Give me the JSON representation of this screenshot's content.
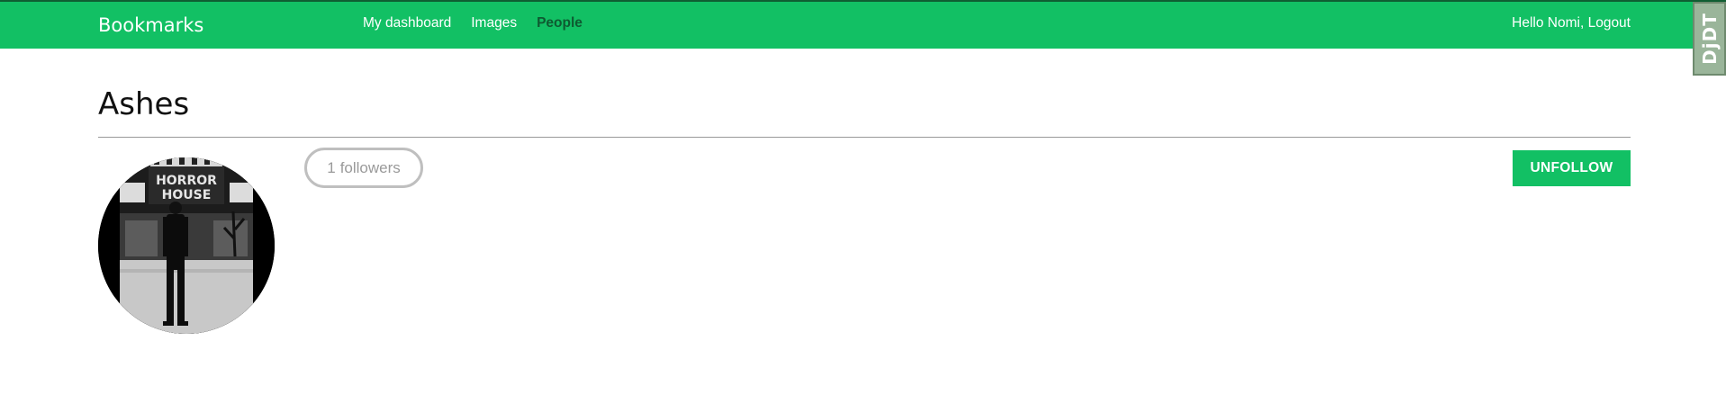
{
  "header": {
    "logo": "Bookmarks",
    "menu": [
      {
        "label": "My dashboard",
        "active": false
      },
      {
        "label": "Images",
        "active": false
      },
      {
        "label": "People",
        "active": true
      }
    ],
    "greeting": "Hello Nomi,",
    "logout_label": "Logout"
  },
  "debug_toolbar": {
    "label": "DjDT"
  },
  "profile": {
    "name": "Ashes",
    "followers_count": "1",
    "followers_label": "followers",
    "unfollow_label": "UNFOLLOW",
    "avatar": {
      "sign_line1": "HORROR",
      "sign_line2": "HOUSE"
    }
  },
  "colors": {
    "brand_green": "#12c064",
    "active_menu": "#0e5a31",
    "pill_border": "#bfbfbf",
    "pill_text": "#9a9a9a",
    "divider": "#999999"
  }
}
